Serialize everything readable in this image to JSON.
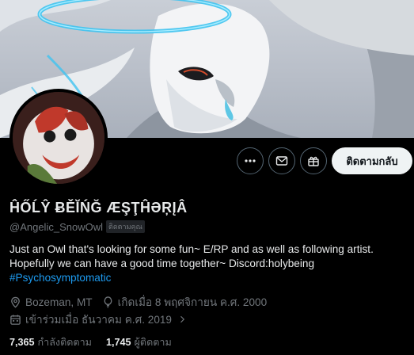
{
  "profile": {
    "display_name": "ĤŐĹŶ ɃĚĬŃĞ ÆŞŢĤƏŖĮÂ",
    "handle": "@Angelic_SnowOwl",
    "follows_you_badge": "ติดตามคุณ",
    "bio_line1": "Just an Owl that's looking for some fun~ E/RP and as well as following artist.",
    "bio_line2": "Hopefully we can have a good time together~ Discord:holybeing",
    "hashtag": "#Psychosymptomatic",
    "location": "Bozeman, MT",
    "birthday": "เกิดเมื่อ 8 พฤศจิกายน ค.ศ. 2000",
    "joined": "เข้าร่วมเมื่อ ธันวาคม ค.ศ. 2019"
  },
  "actions": {
    "more_icon": "more-icon",
    "message_icon": "envelope-icon",
    "subscribe_icon": "gift-icon",
    "follow_label": "ติดตามกลับ"
  },
  "stats": {
    "following_count": "7,365",
    "following_label": "กำลังติดตาม",
    "followers_count": "1,745",
    "followers_label": "ผู้ติดตาม"
  },
  "colors": {
    "background": "#000000",
    "text": "#e7e9ea",
    "muted": "#71767b",
    "link": "#1d9bf0",
    "halo": "#3fc3f0"
  }
}
